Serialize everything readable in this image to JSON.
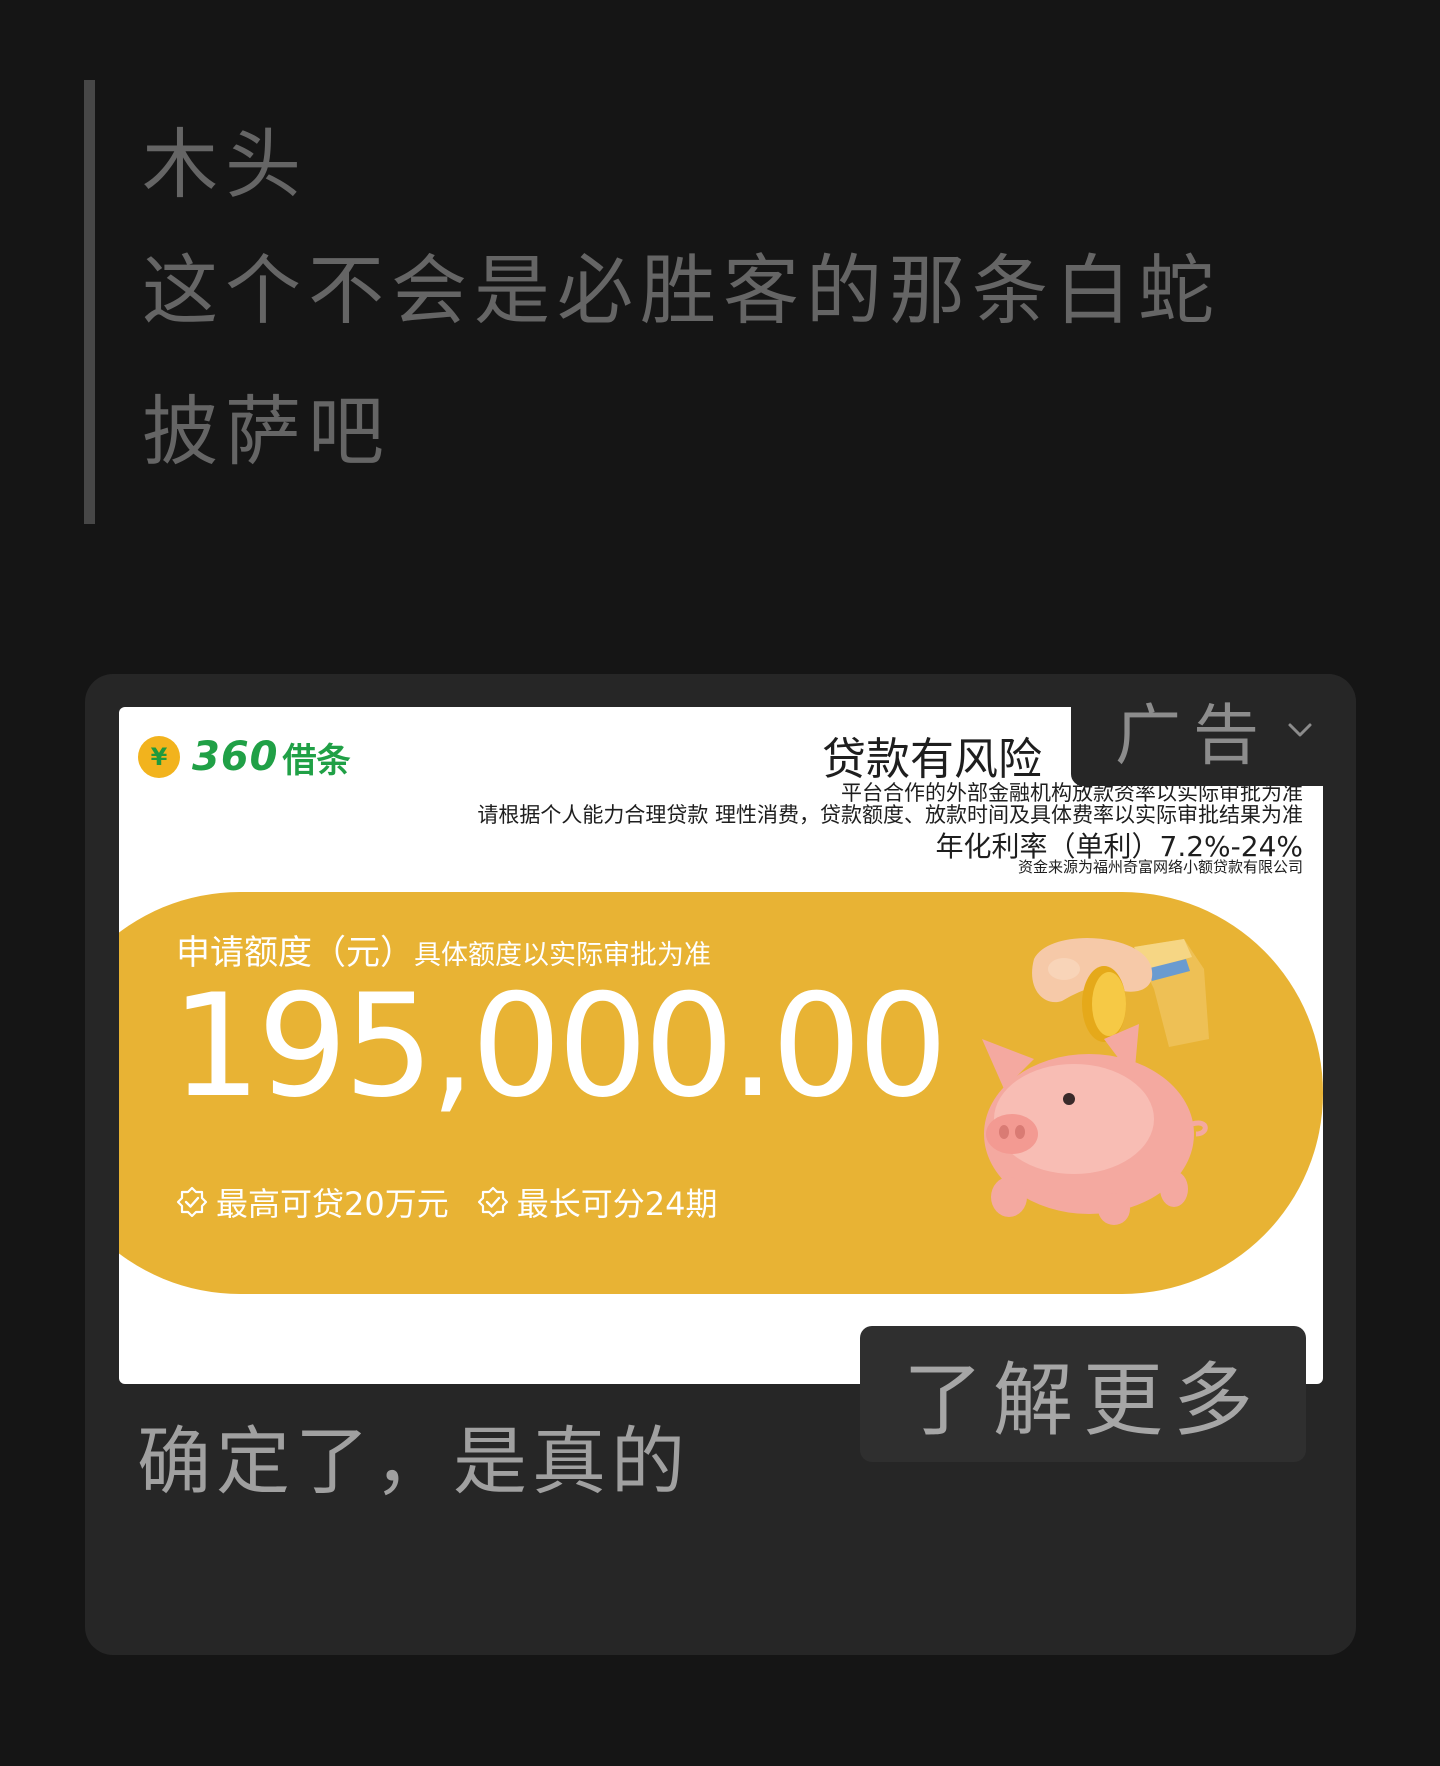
{
  "quote": {
    "author": "木头",
    "line1": "这个不会是必胜客的那条白蛇",
    "line2": "披萨吧"
  },
  "ad": {
    "logo_symbol": "¥",
    "logo_number": "360",
    "logo_name": "借条",
    "risk_title": "贷款有风险",
    "risk_line1": "平台合作的外部金融机构放款资率以实际审批为准",
    "risk_line2": "请根据个人能力合理贷款 理性消费，贷款额度、放款时间及具体费率以实际审批结果为准",
    "risk_line3": "年化利率（单利）7.2%-24%",
    "risk_line4": "资金来源为福州奇富网络小额贷款有限公司",
    "apply_label": "申请额度（元）",
    "apply_note": "具体额度以实际审批为准",
    "amount": "195,000.00",
    "badge1": "最高可贷20万元",
    "badge2": "最长可分24期",
    "ad_label": "广告",
    "caption": "确定了，是真的",
    "cta": "了解更多",
    "colors": {
      "banner": "#e8b334",
      "brand_green": "#20a046"
    }
  }
}
